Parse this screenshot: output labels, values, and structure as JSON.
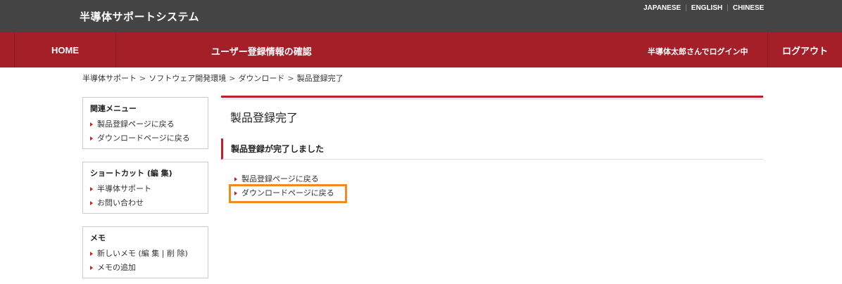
{
  "header": {
    "site_title": "半導体サポートシステム",
    "languages": [
      "JAPANESE",
      "ENGLISH",
      "CHINESE"
    ]
  },
  "nav": {
    "home": "HOME",
    "page_title": "ユーザー登録情報の確認",
    "user_status": "半導体太郎さんでログイン中",
    "logout": "ログアウト"
  },
  "breadcrumb": [
    "半導体サポート",
    "ソフトウェア開発環境",
    "ダウンロード",
    "製品登録完了"
  ],
  "sidebar": {
    "related": {
      "title": "関連メニュー",
      "items": [
        "製品登録ページに戻る",
        "ダウンロードページに戻る"
      ]
    },
    "shortcut": {
      "title": "ショートカット (編 集)",
      "items": [
        "半導体サポート",
        "お問い合わせ"
      ]
    },
    "memo": {
      "title": "メモ",
      "items": [
        "新しいメモ (編 集 | 削 除)",
        "メモの追加"
      ]
    }
  },
  "main": {
    "title": "製品登録完了",
    "section_title": "製品登録が完了しました",
    "links": [
      "製品登録ページに戻る",
      "ダウンロードページに戻る"
    ]
  },
  "colors": {
    "topbar": "#444444",
    "navbar": "#a51f28",
    "accent": "#c0202a",
    "highlight": "#f28a24"
  }
}
